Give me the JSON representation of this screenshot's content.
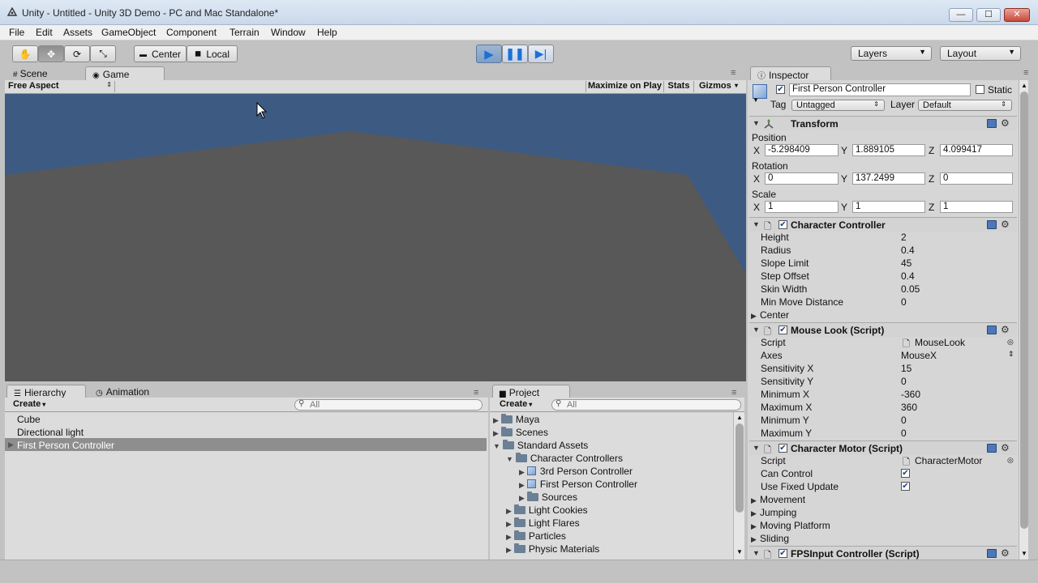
{
  "window": {
    "title": "Unity - Untitled - Unity 3D Demo - PC and Mac Standalone*",
    "minimize": "—",
    "maximize": "☐",
    "close": "✕"
  },
  "menu": [
    "File",
    "Edit",
    "Assets",
    "GameObject",
    "Component",
    "Terrain",
    "Window",
    "Help"
  ],
  "toolbar": {
    "center": "Center",
    "local": "Local",
    "layers": "Layers",
    "layout": "Layout"
  },
  "scene": {
    "tabs": [
      "Scene",
      "Game"
    ],
    "aspect": "Free Aspect",
    "maximize_on_play": "Maximize on Play",
    "stats": "Stats",
    "gizmos": "Gizmos",
    "colors": {
      "sky": "#3d5a83",
      "ground": "#585858"
    }
  },
  "hierarchy": {
    "tabs": [
      "Hierarchy",
      "Animation"
    ],
    "create": "Create",
    "search_placeholder": "All",
    "items": [
      "Cube",
      "Directional light",
      "First Person Controller"
    ]
  },
  "project": {
    "tab": "Project",
    "create": "Create",
    "search_placeholder": "All",
    "items": [
      {
        "label": "Maya",
        "type": "folder",
        "depth": 0,
        "expander": "▶"
      },
      {
        "label": "Scenes",
        "type": "folder",
        "depth": 0,
        "expander": "▶"
      },
      {
        "label": "Standard Assets",
        "type": "folder",
        "depth": 0,
        "expander": "▼"
      },
      {
        "label": "Character Controllers",
        "type": "folder",
        "depth": 1,
        "expander": "▼"
      },
      {
        "label": "3rd Person Controller",
        "type": "prefab",
        "depth": 2,
        "expander": "▶"
      },
      {
        "label": "First Person Controller",
        "type": "prefab",
        "depth": 2,
        "expander": "▶"
      },
      {
        "label": "Sources",
        "type": "folder",
        "depth": 2,
        "expander": "▶"
      },
      {
        "label": "Light Cookies",
        "type": "folder",
        "depth": 1,
        "expander": "▶"
      },
      {
        "label": "Light Flares",
        "type": "folder",
        "depth": 1,
        "expander": "▶"
      },
      {
        "label": "Particles",
        "type": "folder",
        "depth": 1,
        "expander": "▶"
      },
      {
        "label": "Physic Materials",
        "type": "folder",
        "depth": 1,
        "expander": "▶"
      }
    ]
  },
  "inspector": {
    "tab": "Inspector",
    "object_name": "First Person Controller",
    "static": "Static",
    "tag_label": "Tag",
    "tag_value": "Untagged",
    "layer_label": "Layer",
    "layer_value": "Default",
    "transform": {
      "title": "Transform",
      "position_label": "Position",
      "rotation_label": "Rotation",
      "scale_label": "Scale",
      "axis_x": "X",
      "axis_y": "Y",
      "axis_z": "Z",
      "position": [
        "-5.298409",
        "1.889105",
        "4.099417"
      ],
      "rotation": [
        "0",
        "137.2499",
        "0"
      ],
      "scale": [
        "1",
        "1",
        "1"
      ]
    },
    "character_controller": {
      "title": "Character Controller",
      "props": [
        {
          "label": "Height",
          "value": "2"
        },
        {
          "label": "Radius",
          "value": "0.4"
        },
        {
          "label": "Slope Limit",
          "value": "45"
        },
        {
          "label": "Step Offset",
          "value": "0.4"
        },
        {
          "label": "Skin Width",
          "value": "0.05"
        },
        {
          "label": "Min Move Distance",
          "value": "0"
        }
      ],
      "center": "Center"
    },
    "mouse_look": {
      "title": "Mouse Look (Script)",
      "script_label": "Script",
      "script_value": "MouseLook",
      "axes_label": "Axes",
      "axes_value": "MouseX",
      "props": [
        {
          "label": "Sensitivity X",
          "value": "15"
        },
        {
          "label": "Sensitivity Y",
          "value": "0"
        },
        {
          "label": "Minimum X",
          "value": "-360"
        },
        {
          "label": "Maximum X",
          "value": "360"
        },
        {
          "label": "Minimum Y",
          "value": "0"
        },
        {
          "label": "Maximum Y",
          "value": "0"
        }
      ]
    },
    "character_motor": {
      "title": "Character Motor (Script)",
      "script_label": "Script",
      "script_value": "CharacterMotor",
      "can_control": "Can Control",
      "use_fixed_update": "Use Fixed Update",
      "foldouts": [
        "Movement",
        "Jumping",
        "Moving Platform",
        "Sliding"
      ]
    },
    "fps_input": {
      "title": "FPSInput Controller (Script)"
    }
  }
}
